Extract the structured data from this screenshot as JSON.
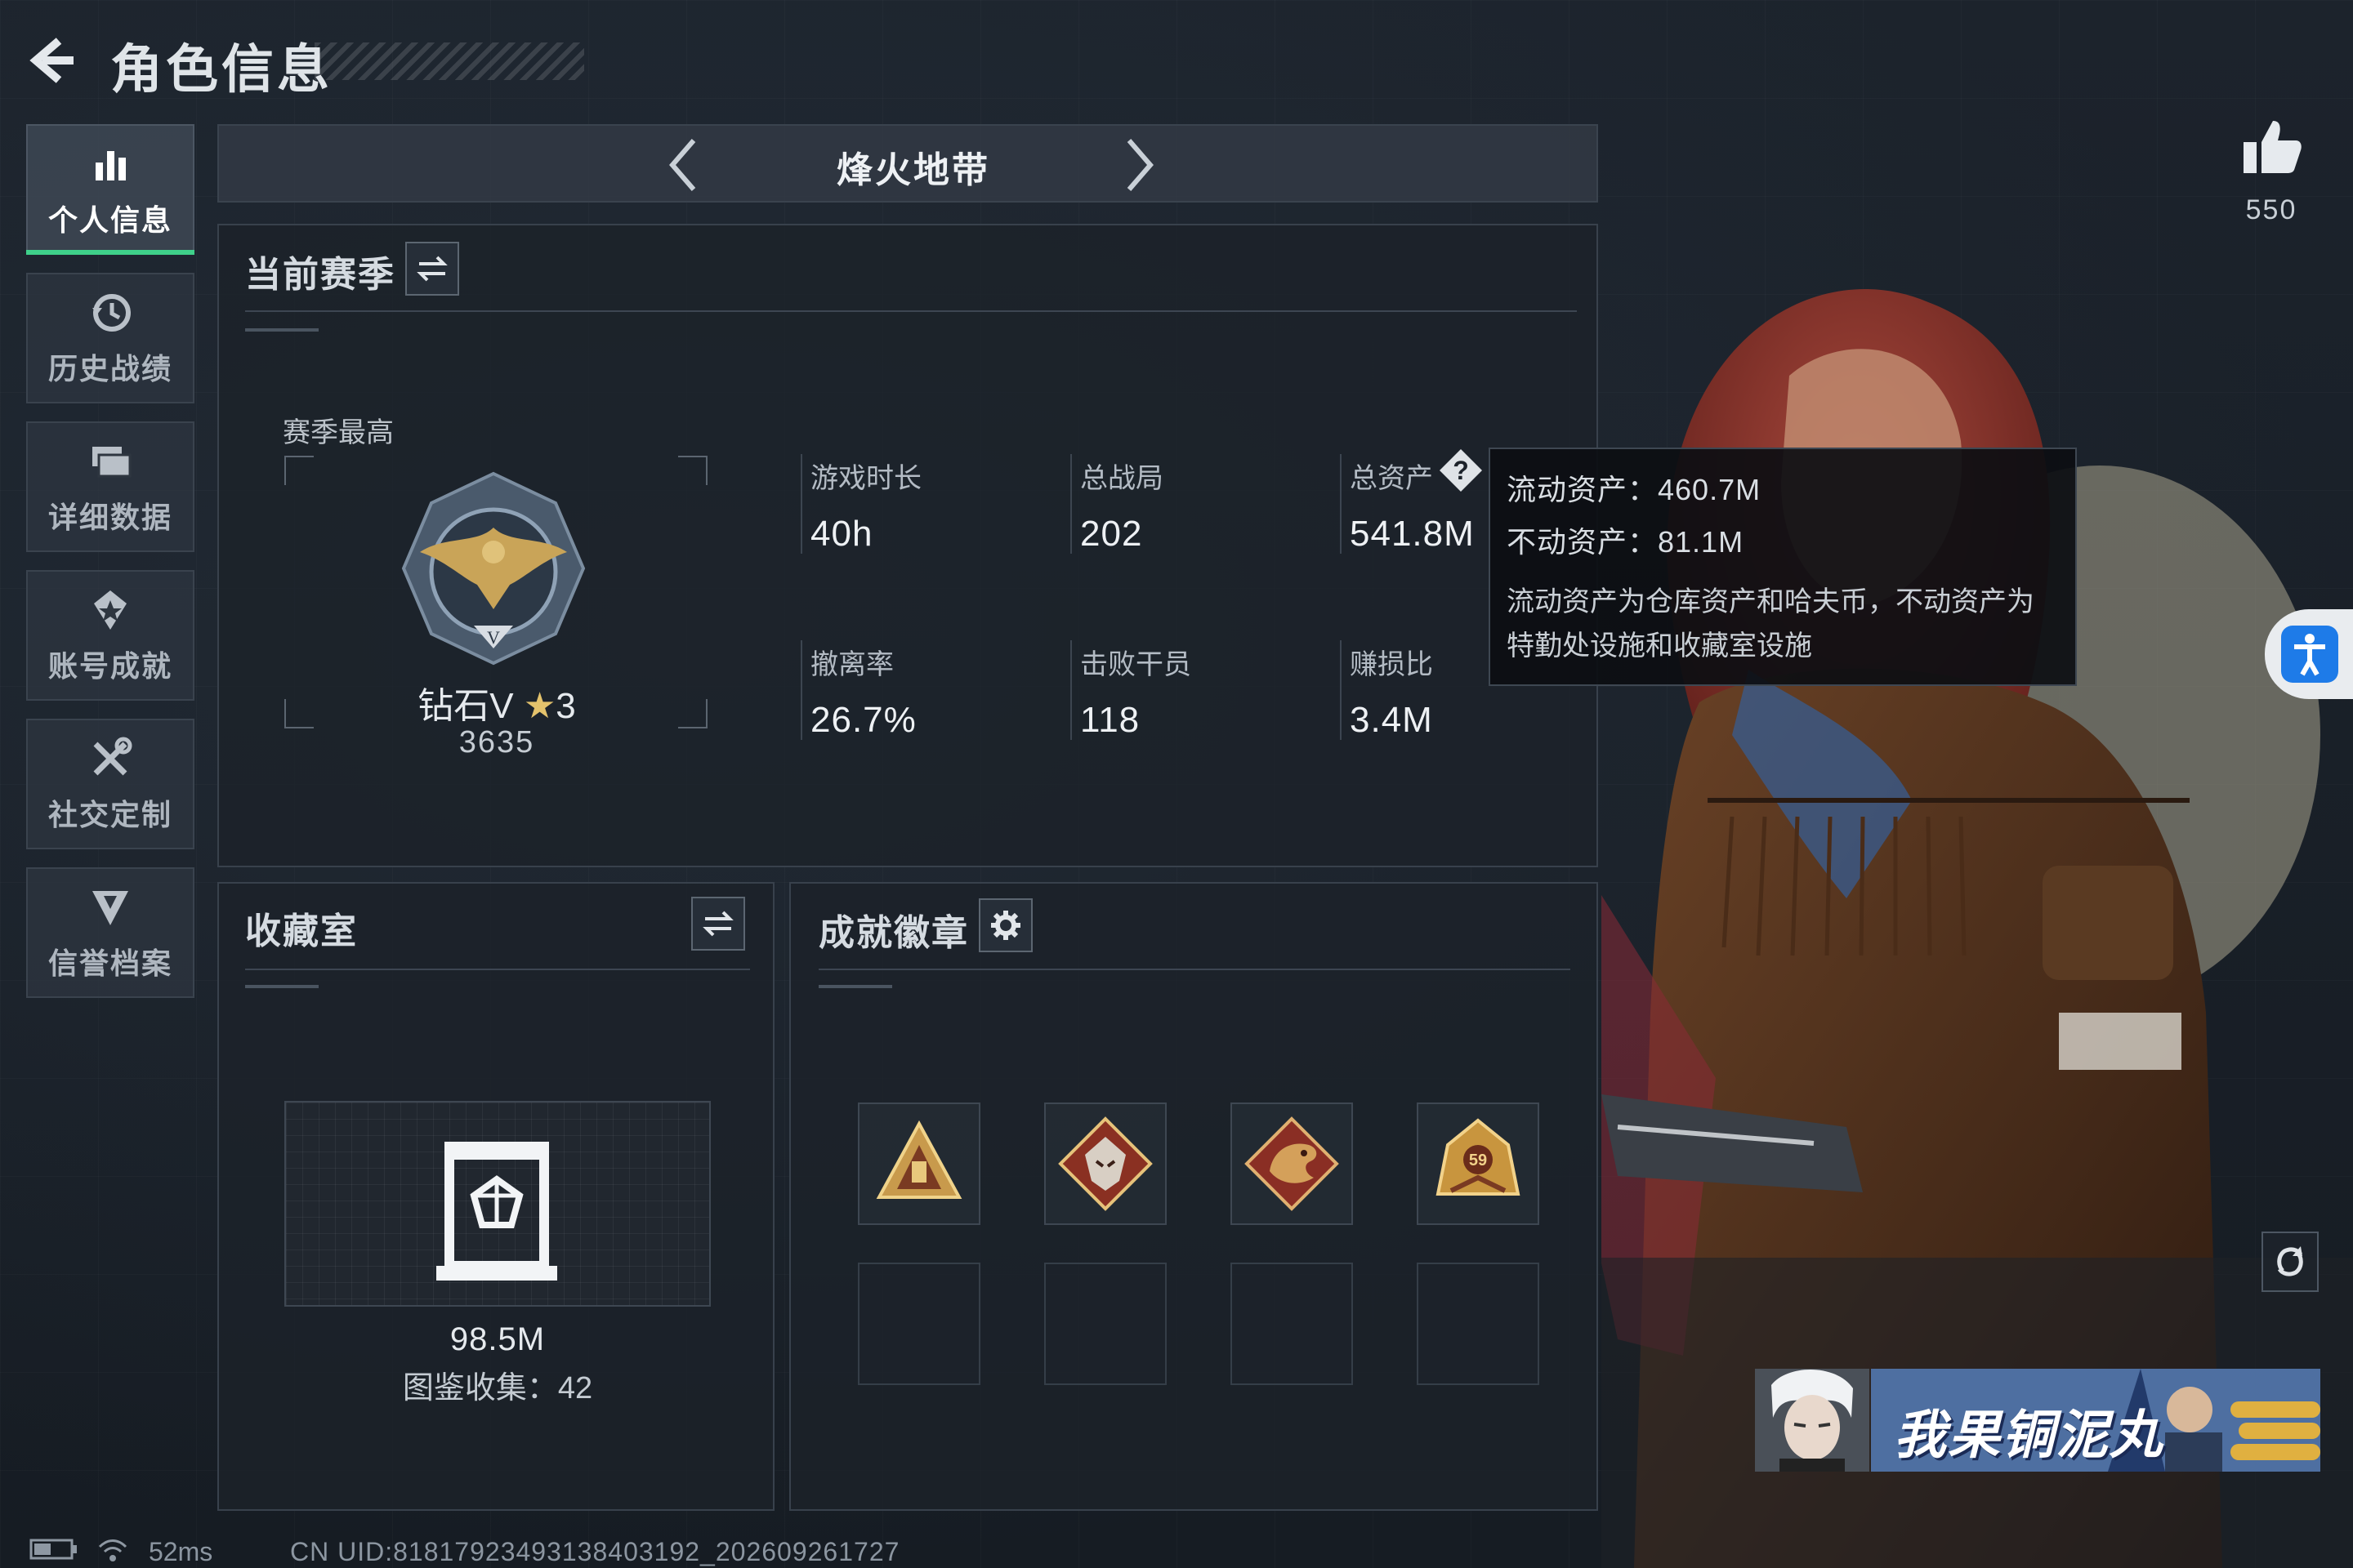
{
  "header": {
    "title": "角色信息"
  },
  "sidebar": {
    "items": [
      {
        "label": "个人信息",
        "active": true
      },
      {
        "label": "历史战绩"
      },
      {
        "label": "详细数据"
      },
      {
        "label": "账号成就"
      },
      {
        "label": "社交定制"
      },
      {
        "label": "信誉档案"
      }
    ]
  },
  "mode_tab": {
    "title": "烽火地带"
  },
  "season": {
    "title": "当前赛季",
    "best_label": "赛季最高",
    "rank_name": "钻石V",
    "rank_stars": "3",
    "rank_score": "3635",
    "stats": {
      "playtime": {
        "label": "游戏时长",
        "value": "40h"
      },
      "matches": {
        "label": "总战局",
        "value": "202"
      },
      "assets": {
        "label": "总资产",
        "value": "541.8M"
      },
      "extract_rate": {
        "label": "撤离率",
        "value": "26.7%"
      },
      "kills": {
        "label": "击败干员",
        "value": "118"
      },
      "profit_ratio": {
        "label": "赚损比",
        "value": "3.4M"
      }
    }
  },
  "tooltip": {
    "liquid_label": "流动资产：",
    "liquid_value": "460.7M",
    "fixed_label": "不动资产：",
    "fixed_value": "81.1M",
    "description": "流动资产为仓库资产和哈夫币，不动资产为特勤处设施和收藏室设施"
  },
  "collection": {
    "title": "收藏室",
    "value": "98.5M",
    "count_label": "图鉴收集：",
    "count_value": "42"
  },
  "achievements": {
    "title": "成就徽章",
    "badges": [
      {
        "icon": "triangle-badge-icon"
      },
      {
        "icon": "wolf-badge-icon"
      },
      {
        "icon": "dragon-badge-icon"
      },
      {
        "icon": "crest-59-badge-icon"
      }
    ],
    "crest_number": "59"
  },
  "likes": {
    "count": "550"
  },
  "banner": {
    "text": "我果铜泥丸"
  },
  "status_bar": {
    "ping": "52ms",
    "uid": "CN UID:8181792349313840319​2_202609261727"
  },
  "colors": {
    "accent_green": "#3fd08a",
    "gold": "#e3c26c",
    "panel_bg": "#1c222a",
    "tooltip_bg": "#0c0e12",
    "access_blue": "#1e7be8"
  }
}
